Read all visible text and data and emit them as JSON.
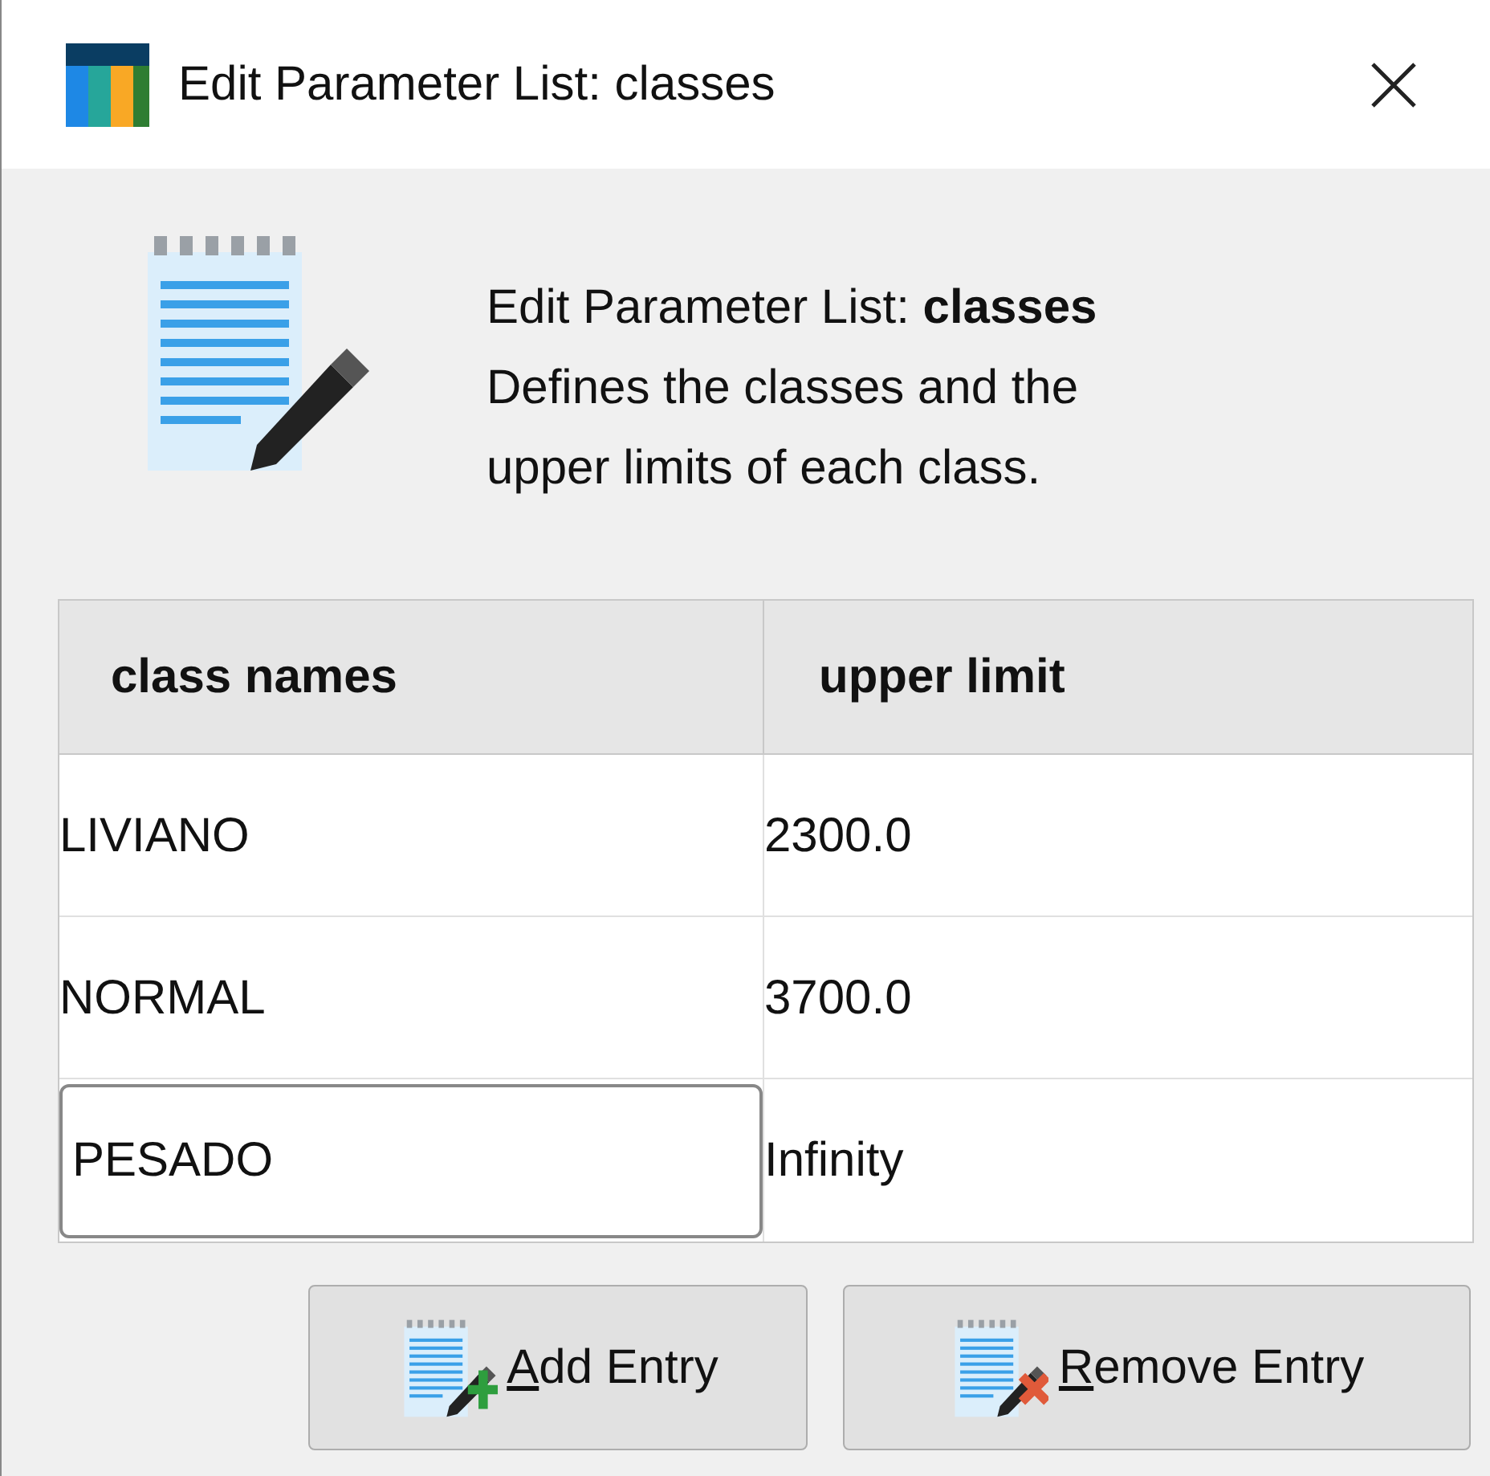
{
  "window": {
    "title": "Edit Parameter List: classes"
  },
  "header": {
    "title": "Edit Parameter List: **classes**",
    "description": "Defines the classes and the upper limits of each class."
  },
  "table": {
    "columns": [
      "class names",
      "upper limit"
    ],
    "rows": [
      {
        "cells": [
          "LIVIANO",
          "2300.0"
        ],
        "editing": false
      },
      {
        "cells": [
          "NORMAL",
          "3700.0"
        ],
        "editing": false
      },
      {
        "cells": [
          "PESADO",
          "Infinity"
        ],
        "editing": true
      }
    ]
  },
  "buttons": [
    {
      "label": "Add Entry",
      "kind": "add",
      "mnemonic_underlined": true
    },
    {
      "label": "Remove Entry",
      "kind": "remove",
      "mnemonic_underlined": true
    }
  ]
}
